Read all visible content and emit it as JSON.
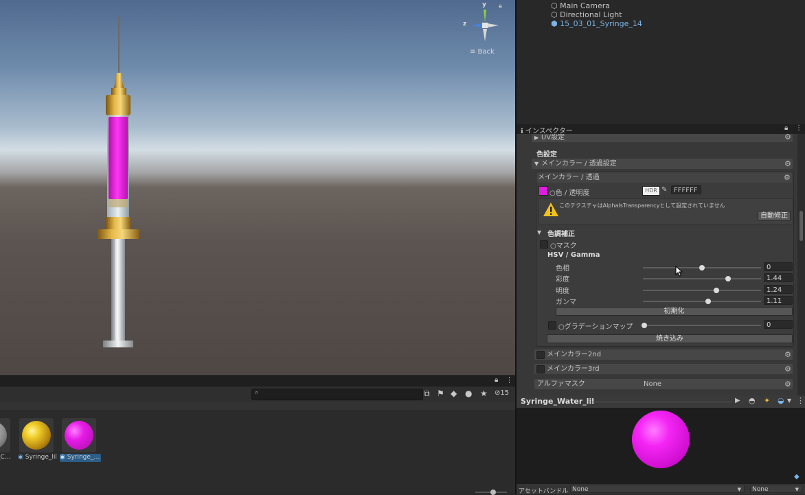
{
  "scene": {
    "gizmo": {
      "y_label": "y",
      "z_label": "z"
    },
    "back_label": "≡ Back"
  },
  "hierarchy": {
    "items": [
      "Main Camera",
      "Directional Light",
      "15_03_01_Syringe_14"
    ]
  },
  "inspector": {
    "tab_label": "インスペクター",
    "uv_header": "UV設定",
    "color_settings_title": "色設定",
    "main_color_header": "メインカラー / 透過設定",
    "main_color_sub": "メインカラー / 透過",
    "color_alpha_label": "○色 / 透明度",
    "hdr_label": "HDR",
    "hex_value": "FFFFFF",
    "warning_text": "このテクスチャはAlphaIsTransparencyとして設定されていません",
    "auto_fix_label": "自動修正",
    "tone_correction_title": "色調補正",
    "mask_label": "○マスク",
    "hsv_title": "HSV / Gamma",
    "sliders": [
      {
        "label": "色相",
        "value": "0",
        "pos": 0.5
      },
      {
        "label": "彩度",
        "value": "1.44",
        "pos": 0.72
      },
      {
        "label": "明度",
        "value": "1.24",
        "pos": 0.62
      },
      {
        "label": "ガンマ",
        "value": "1.11",
        "pos": 0.555
      }
    ],
    "reset_label": "初期化",
    "gradation_label": "○グラデーションマップ",
    "gradation_value": "0",
    "bake_label": "焼き込み",
    "main_color_2nd": "メインカラー2nd",
    "main_color_3rd": "メインカラー3rd",
    "alpha_mask_label": "アルファマスク",
    "alpha_mask_value": "None"
  },
  "preview": {
    "material_name": "Syringe_Water_lil"
  },
  "asset_bundle": {
    "label": "アセットバンドル",
    "value1": "None",
    "value2": "None"
  },
  "project": {
    "hidden_count": "15",
    "assets": [
      {
        "label": "_C…",
        "color": "#8a8a8a"
      },
      {
        "label": "Syringe_lil",
        "color": "#d4a017"
      },
      {
        "label": "Syringe_…",
        "color": "#e020d8"
      }
    ]
  },
  "colors": {
    "accent_selected": "#2c5d87",
    "magenta": "#e01ce0",
    "gold": "#c8961e",
    "link_blue": "#7cb4e8"
  }
}
